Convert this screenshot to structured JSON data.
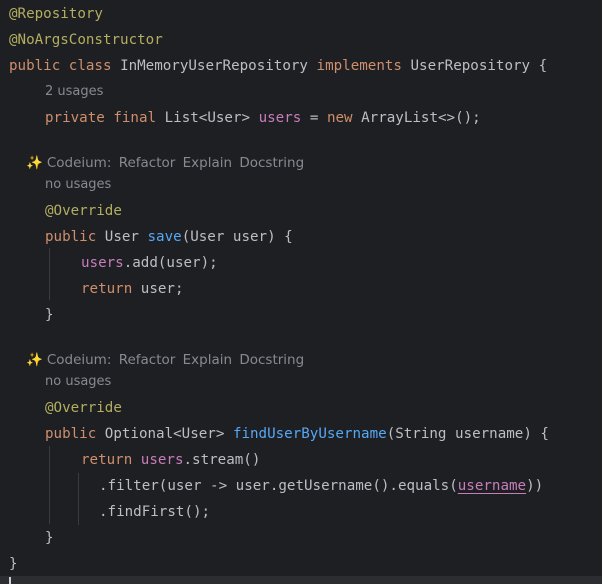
{
  "code": {
    "l1": "@Repository",
    "l2": "@NoArgsConstructor",
    "l3": {
      "k1": "public",
      "k2": "class",
      "name": "InMemoryUserRepository",
      "k3": "implements",
      "iface": "UserRepository",
      "brace": "{"
    },
    "usages1": "2 usages",
    "l4": {
      "k1": "private",
      "k2": "final",
      "type": "List<User>",
      "field": "users",
      "eq": "=",
      "k3": "new",
      "rest": "ArrayList<>();"
    },
    "lens1": {
      "icon": "✨",
      "title": "Codeium:",
      "refactor": "Refactor",
      "explain": "Explain",
      "docstring": "Docstring"
    },
    "usages2": "no usages",
    "l5": "@Override",
    "l6": {
      "k1": "public",
      "pre": "User",
      "fn": "save",
      "rest": "(User user) {"
    },
    "l7": {
      "field": "users",
      "rest": ".add(user);"
    },
    "l8": {
      "k1": "return",
      "rest": "user;"
    },
    "l9": "}",
    "lens2": {
      "icon": "✨",
      "title": "Codeium:",
      "refactor": "Refactor",
      "explain": "Explain",
      "docstring": "Docstring"
    },
    "usages3": "no usages",
    "l10": "@Override",
    "l11": {
      "k1": "public",
      "pre": "Optional<User>",
      "fn": "findUserByUsername",
      "rest": "(String username) {"
    },
    "l12": {
      "k1": "return",
      "field": "users",
      "rest": ".stream()"
    },
    "l13": {
      "pre": ".filter(user -> user.getUsername().equals(",
      "param": "username",
      "post": "))"
    },
    "l14": ".findFirst();",
    "l15": "}",
    "l16": "}"
  },
  "colors": {
    "background": "#1e1f22",
    "keyword": "#cf8e6d",
    "annotation": "#b3ae60",
    "field": "#c77dbb",
    "function": "#56a8f5",
    "text": "#bcbec4",
    "hint": "#868a91"
  }
}
